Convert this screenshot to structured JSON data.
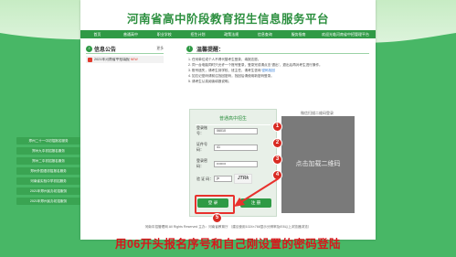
{
  "header": {
    "title": "河南省高中阶段教育招生信息服务平台"
  },
  "nav": {
    "items": [
      "首页",
      "普通高中",
      "职业学校",
      "招生计划",
      "政策法规",
      "信息查询",
      "服务指南",
      "欢迎光临河南省中招管理平台"
    ]
  },
  "notice": {
    "title": "信息公告",
    "more": "更多",
    "item_text": "2021年河南省中招填报",
    "item_tag": "NEW"
  },
  "side_links": [
    "郑州二十一中初招报名服务",
    "郑州九中初招报名服务",
    "郑州二中初招报名服务",
    "郑州外国语初招报名服务",
    "河南省实验中学初招服务",
    "2021年郑州民办初招服务",
    "2021年郑州民办初招服务"
  ],
  "tips": {
    "title": "温馨提醒：",
    "lines": [
      "1. 任何单位或个人不得代替考生登录、填报志愿。",
      "2. 同一台电脑同时只允许一个账号登录，登录完成请点击“退出”，退出后再对考生进行操作。",
      "3. 账号遗失，请考生到学校、班主任、请考生咨询",
      "4. 如忘记密码请前往找回密码，找回后请使用新密码登录。",
      "5. 请考生认真阅读填报说明。"
    ],
    "link_text": "密码找回"
  },
  "login": {
    "heading": "普通高中招生",
    "fields": [
      {
        "label": "登录账号：",
        "value": "06010",
        "placeholder": ""
      },
      {
        "label": "证件号码：",
        "value": "41",
        "placeholder": ""
      },
      {
        "label": "登录密码：",
        "value": "••••••••",
        "placeholder": ""
      },
      {
        "label": "验 证 码：",
        "value": "jtr",
        "placeholder": ""
      }
    ],
    "captcha_text": "JTRk",
    "login_button": "登 录",
    "register_button": "注 册"
  },
  "qr": {
    "caption": "微信扫描二维码登录",
    "placeholder": "点击加载二维码"
  },
  "steps": [
    "1",
    "2",
    "3",
    "4",
    "5"
  ],
  "footer": {
    "text": "河南中招管理网 All Rights Reserved 主办：河南省教育厅 （建议使用1024×768显示分辨率及IE8以上浏览器浏览）"
  },
  "caption": {
    "text": "用06开头报名序号和自己刚设置的密码登陆"
  },
  "colors": {
    "accent": "#2f9a45",
    "background": "#48b766",
    "highlight": "#e8312d",
    "caption": "#d8171c"
  }
}
